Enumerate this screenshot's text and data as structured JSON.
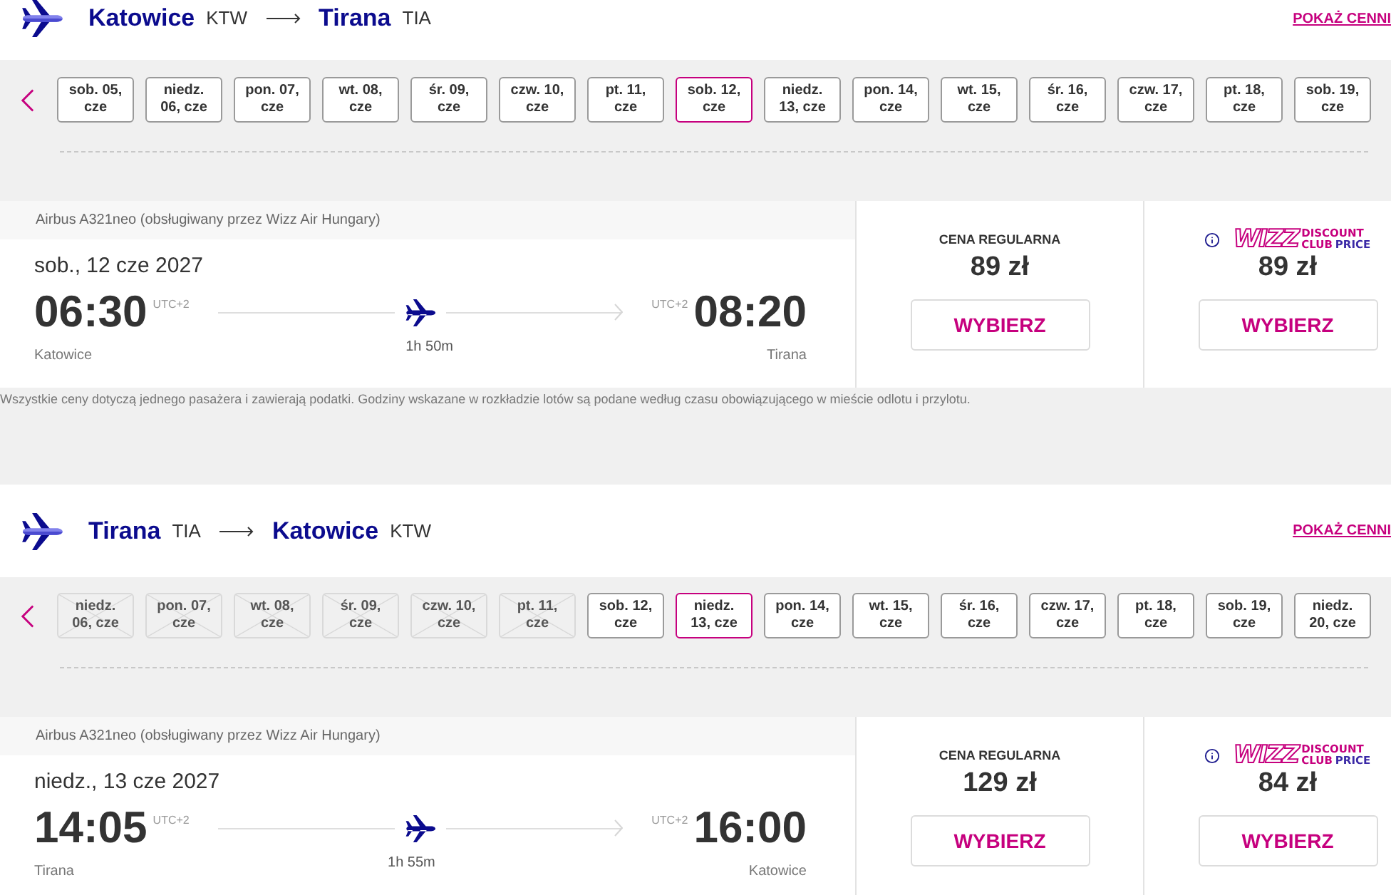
{
  "sections": [
    {
      "route": {
        "origin": {
          "city": "Katowice",
          "code": "KTW"
        },
        "destination": {
          "city": "Tirana",
          "code": "TIA"
        }
      },
      "price_list_link": "POKAŻ CENNI",
      "dates": [
        {
          "lines": [
            "sob. 05,",
            "cze"
          ],
          "selected": false,
          "disabled": false
        },
        {
          "lines": [
            "niedz.",
            "06, cze"
          ],
          "selected": false,
          "disabled": false
        },
        {
          "lines": [
            "pon. 07,",
            "cze"
          ],
          "selected": false,
          "disabled": false
        },
        {
          "lines": [
            "wt. 08,",
            "cze"
          ],
          "selected": false,
          "disabled": false
        },
        {
          "lines": [
            "śr. 09,",
            "cze"
          ],
          "selected": false,
          "disabled": false
        },
        {
          "lines": [
            "czw. 10,",
            "cze"
          ],
          "selected": false,
          "disabled": false
        },
        {
          "lines": [
            "pt. 11,",
            "cze"
          ],
          "selected": false,
          "disabled": false
        },
        {
          "lines": [
            "sob. 12,",
            "cze"
          ],
          "selected": true,
          "disabled": false
        },
        {
          "lines": [
            "niedz.",
            "13, cze"
          ],
          "selected": false,
          "disabled": false
        },
        {
          "lines": [
            "pon. 14,",
            "cze"
          ],
          "selected": false,
          "disabled": false
        },
        {
          "lines": [
            "wt. 15,",
            "cze"
          ],
          "selected": false,
          "disabled": false
        },
        {
          "lines": [
            "śr. 16,",
            "cze"
          ],
          "selected": false,
          "disabled": false
        },
        {
          "lines": [
            "czw. 17,",
            "cze"
          ],
          "selected": false,
          "disabled": false
        },
        {
          "lines": [
            "pt. 18,",
            "cze"
          ],
          "selected": false,
          "disabled": false
        },
        {
          "lines": [
            "sob. 19,",
            "cze"
          ],
          "selected": false,
          "disabled": false
        }
      ],
      "flight": {
        "aircraft": "Airbus A321neo (obsługiwany przez Wizz Air Hungary)",
        "date": "sob., 12 cze 2027",
        "departure": {
          "time": "06:30",
          "utc": "UTC+2",
          "city": "Katowice"
        },
        "arrival": {
          "time": "08:20",
          "utc": "UTC+2",
          "city": "Tirana"
        },
        "duration": "1h 50m",
        "fares": [
          {
            "kind": "regular",
            "label": "CENA REGULARNA",
            "price": "89 zł",
            "button": "WYBIERZ"
          },
          {
            "kind": "club",
            "logo": {
              "wordmark": "WIZZ",
              "top": "DISCOUNT",
              "bottom_left": "CLUB",
              "bottom_right": "PRICE"
            },
            "price": "89 zł",
            "button": "WYBIERZ"
          }
        ]
      },
      "note": "Wszystkie ceny dotyczą jednego pasażera i zawierają podatki. Godziny wskazane w rozkładzie lotów są podane według czasu obowiązującego w mieście odlotu i przylotu."
    },
    {
      "route": {
        "origin": {
          "city": "Tirana",
          "code": "TIA"
        },
        "destination": {
          "city": "Katowice",
          "code": "KTW"
        }
      },
      "price_list_link": "POKAŻ CENNI",
      "dates": [
        {
          "lines": [
            "niedz.",
            "06, cze"
          ],
          "selected": false,
          "disabled": true
        },
        {
          "lines": [
            "pon. 07,",
            "cze"
          ],
          "selected": false,
          "disabled": true
        },
        {
          "lines": [
            "wt. 08,",
            "cze"
          ],
          "selected": false,
          "disabled": true
        },
        {
          "lines": [
            "śr. 09,",
            "cze"
          ],
          "selected": false,
          "disabled": true
        },
        {
          "lines": [
            "czw. 10,",
            "cze"
          ],
          "selected": false,
          "disabled": true
        },
        {
          "lines": [
            "pt. 11,",
            "cze"
          ],
          "selected": false,
          "disabled": true
        },
        {
          "lines": [
            "sob. 12,",
            "cze"
          ],
          "selected": false,
          "disabled": false
        },
        {
          "lines": [
            "niedz.",
            "13, cze"
          ],
          "selected": true,
          "disabled": false
        },
        {
          "lines": [
            "pon. 14,",
            "cze"
          ],
          "selected": false,
          "disabled": false
        },
        {
          "lines": [
            "wt. 15,",
            "cze"
          ],
          "selected": false,
          "disabled": false
        },
        {
          "lines": [
            "śr. 16,",
            "cze"
          ],
          "selected": false,
          "disabled": false
        },
        {
          "lines": [
            "czw. 17,",
            "cze"
          ],
          "selected": false,
          "disabled": false
        },
        {
          "lines": [
            "pt. 18,",
            "cze"
          ],
          "selected": false,
          "disabled": false
        },
        {
          "lines": [
            "sob. 19,",
            "cze"
          ],
          "selected": false,
          "disabled": false
        },
        {
          "lines": [
            "niedz.",
            "20, cze"
          ],
          "selected": false,
          "disabled": false
        }
      ],
      "flight": {
        "aircraft": "Airbus A321neo (obsługiwany przez Wizz Air Hungary)",
        "date": "niedz., 13 cze 2027",
        "departure": {
          "time": "14:05",
          "utc": "UTC+2",
          "city": "Tirana"
        },
        "arrival": {
          "time": "16:00",
          "utc": "UTC+2",
          "city": "Katowice"
        },
        "duration": "1h 55m",
        "fares": [
          {
            "kind": "regular",
            "label": "CENA REGULARNA",
            "price": "129 zł",
            "button": "WYBIERZ"
          },
          {
            "kind": "club",
            "logo": {
              "wordmark": "WIZZ",
              "top": "DISCOUNT",
              "bottom_left": "CLUB",
              "bottom_right": "PRICE"
            },
            "price": "84 zł",
            "button": "WYBIERZ"
          }
        ]
      }
    }
  ]
}
